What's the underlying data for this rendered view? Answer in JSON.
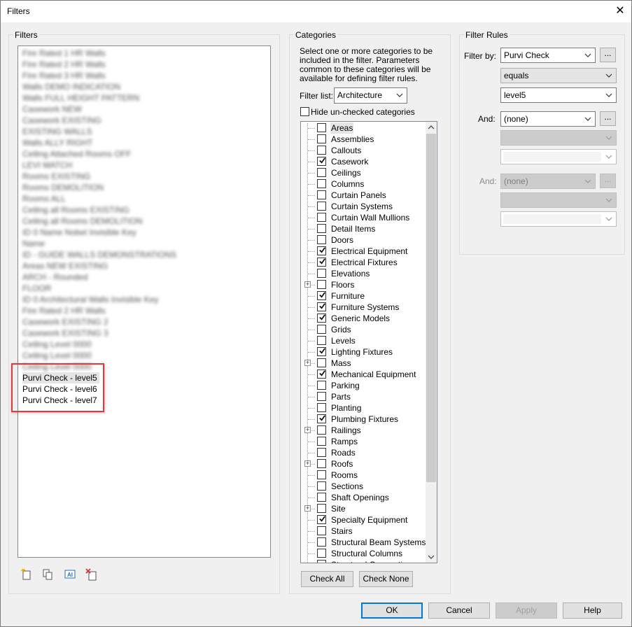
{
  "window": {
    "title": "Filters",
    "close_glyph": "✕"
  },
  "filters_panel": {
    "label": "Filters",
    "blurred_items": [
      "Fire Rated 1 HR Walls",
      "Fire Rated 2 HR Walls",
      "Fire Rated 3 HR Walls",
      "Walls DEMO INDICATION",
      "Walls FULL HEIGHT PATTERN",
      "Casework NEW",
      "Casework EXISTING",
      "EXISTING WALLS",
      "Walls ALLY RIGHT",
      "Ceiling Attached Rooms OFF",
      "LEVI MATCH",
      "Rooms EXISTING",
      "Rooms DEMOLITION",
      "Rooms ALL",
      "Ceiling all Rooms EXISTING",
      "Ceiling all Rooms DEMOLITION",
      "ID 0 Name Nobel Invisible Key",
      "Name",
      "ID - GUIDE WALLS DEMONSTRATIONS",
      "Areas NEW EXISTING",
      "ARCH - Rounded",
      "FLOOR",
      "ID 0 Architectural Walls Invisible Key",
      "Fire Rated 2 HR Walls",
      "Casework EXISTING 2",
      "Casework EXISTING 3",
      "Ceiling Level 0000",
      "Ceiling Level 0000",
      "Ceiling Level 0000"
    ],
    "items": [
      "Purvi Check - level5",
      "Purvi Check - level6",
      "Purvi Check - level7"
    ],
    "toolbar_icons": [
      "new-filter-icon",
      "duplicate-filter-icon",
      "rename-filter-icon",
      "delete-filter-icon"
    ]
  },
  "categories_panel": {
    "label": "Categories",
    "description_lines": [
      "Select one or more categories to be",
      "included in the filter.  Parameters",
      "common to these categories will be",
      "available for defining filter rules."
    ],
    "filter_list_label": "Filter list:",
    "filter_list_value": "Architecture",
    "hide_unchecked_label": "Hide un-checked categories",
    "items": [
      {
        "label": "Areas",
        "checked": false,
        "expandable": false,
        "selected": true
      },
      {
        "label": "Assemblies",
        "checked": false,
        "expandable": false
      },
      {
        "label": "Callouts",
        "checked": false,
        "expandable": false
      },
      {
        "label": "Casework",
        "checked": true,
        "expandable": false
      },
      {
        "label": "Ceilings",
        "checked": false,
        "expandable": false
      },
      {
        "label": "Columns",
        "checked": false,
        "expandable": false
      },
      {
        "label": "Curtain Panels",
        "checked": false,
        "expandable": false
      },
      {
        "label": "Curtain Systems",
        "checked": false,
        "expandable": false
      },
      {
        "label": "Curtain Wall Mullions",
        "checked": false,
        "expandable": false
      },
      {
        "label": "Detail Items",
        "checked": false,
        "expandable": false
      },
      {
        "label": "Doors",
        "checked": false,
        "expandable": false
      },
      {
        "label": "Electrical Equipment",
        "checked": true,
        "expandable": false
      },
      {
        "label": "Electrical Fixtures",
        "checked": true,
        "expandable": false
      },
      {
        "label": "Elevations",
        "checked": false,
        "expandable": false
      },
      {
        "label": "Floors",
        "checked": false,
        "expandable": true
      },
      {
        "label": "Furniture",
        "checked": true,
        "expandable": false
      },
      {
        "label": "Furniture Systems",
        "checked": true,
        "expandable": false
      },
      {
        "label": "Generic Models",
        "checked": true,
        "expandable": false
      },
      {
        "label": "Grids",
        "checked": false,
        "expandable": false
      },
      {
        "label": "Levels",
        "checked": false,
        "expandable": false
      },
      {
        "label": "Lighting Fixtures",
        "checked": true,
        "expandable": false
      },
      {
        "label": "Mass",
        "checked": false,
        "expandable": true
      },
      {
        "label": "Mechanical Equipment",
        "checked": true,
        "expandable": false
      },
      {
        "label": "Parking",
        "checked": false,
        "expandable": false
      },
      {
        "label": "Parts",
        "checked": false,
        "expandable": false
      },
      {
        "label": "Planting",
        "checked": false,
        "expandable": false
      },
      {
        "label": "Plumbing Fixtures",
        "checked": true,
        "expandable": false
      },
      {
        "label": "Railings",
        "checked": false,
        "expandable": true
      },
      {
        "label": "Ramps",
        "checked": false,
        "expandable": false
      },
      {
        "label": "Roads",
        "checked": false,
        "expandable": false
      },
      {
        "label": "Roofs",
        "checked": false,
        "expandable": true
      },
      {
        "label": "Rooms",
        "checked": false,
        "expandable": false
      },
      {
        "label": "Sections",
        "checked": false,
        "expandable": false
      },
      {
        "label": "Shaft Openings",
        "checked": false,
        "expandable": false
      },
      {
        "label": "Site",
        "checked": false,
        "expandable": true
      },
      {
        "label": "Specialty Equipment",
        "checked": true,
        "expandable": false
      },
      {
        "label": "Stairs",
        "checked": false,
        "expandable": false
      },
      {
        "label": "Structural Beam Systems",
        "checked": false,
        "expandable": false
      },
      {
        "label": "Structural Columns",
        "checked": false,
        "expandable": false
      },
      {
        "label": "Structural Connections",
        "checked": false,
        "expandable": false
      }
    ],
    "check_all_label": "Check All",
    "check_none_label": "Check None"
  },
  "filter_rules_panel": {
    "label": "Filter Rules",
    "filter_by_label": "Filter by:",
    "filter_by_value": "Purvi Check",
    "operator_value": "equals",
    "value_field": "level5",
    "and1_label": "And:",
    "and1_value": "(none)",
    "and2_label": "And:",
    "and2_value": "(none)",
    "ellipsis": "..."
  },
  "footer": {
    "ok_label": "OK",
    "cancel_label": "Cancel",
    "apply_label": "Apply",
    "help_label": "Help"
  },
  "colors": {
    "highlight_box": "#e0393e",
    "default_button_border": "#0078d7"
  }
}
